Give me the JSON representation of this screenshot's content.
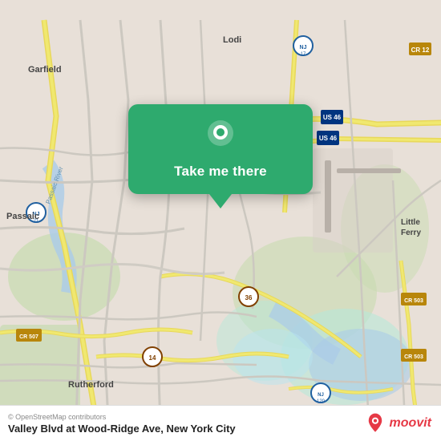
{
  "map": {
    "background_color": "#e8e0d8",
    "popup": {
      "button_label": "Take me there",
      "background_color": "#2eaa6e"
    },
    "bottom_bar": {
      "attribution": "© OpenStreetMap contributors",
      "location_name": "Valley Blvd at Wood-Ridge Ave, New York City"
    },
    "moovit": {
      "text": "moovit"
    }
  }
}
